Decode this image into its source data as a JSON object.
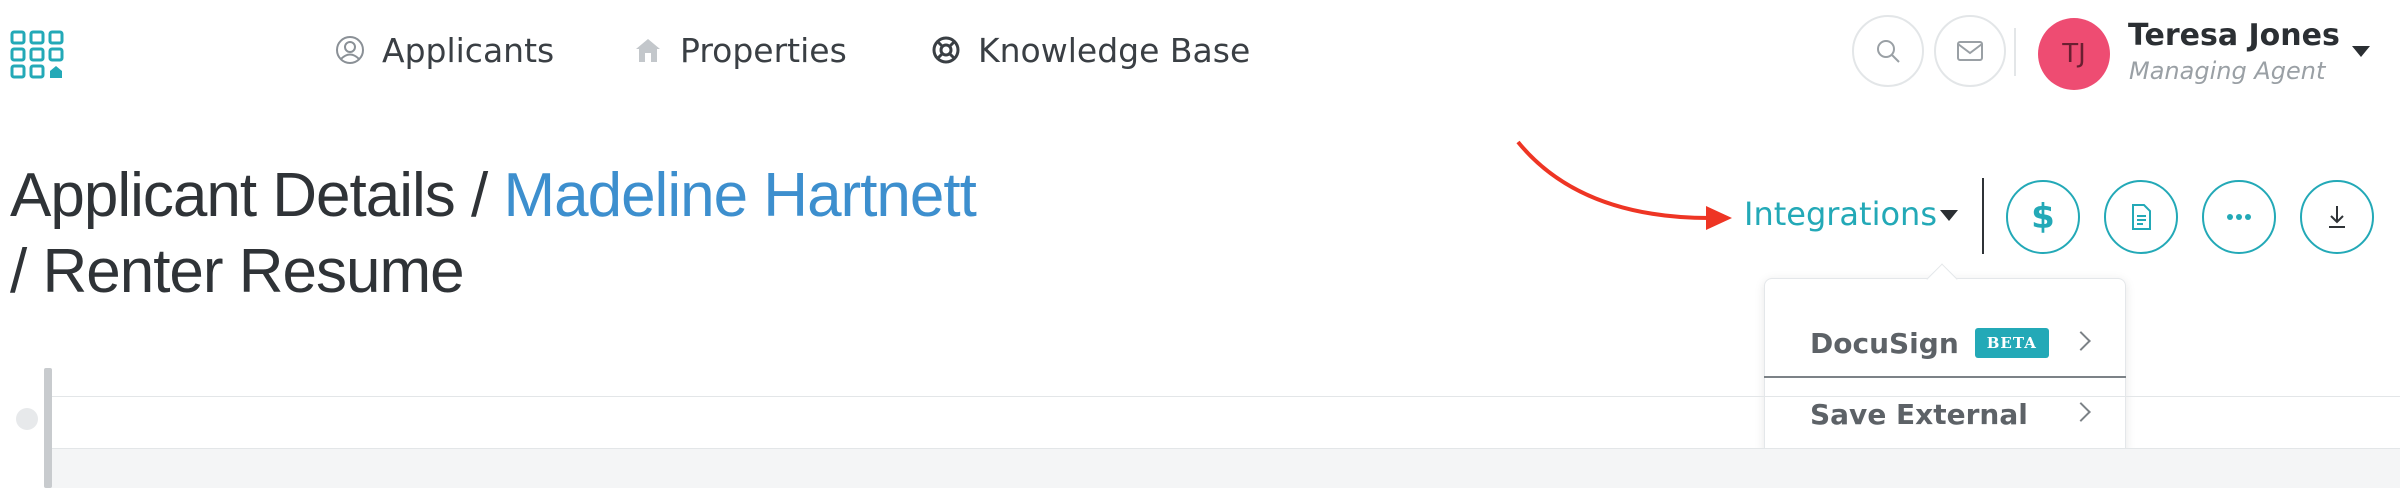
{
  "header": {
    "logo_icon": "grid-logo-icon",
    "nav": [
      {
        "label": "Applicants",
        "icon": "user-circle-icon"
      },
      {
        "label": "Properties",
        "icon": "house-icon"
      },
      {
        "label": "Knowledge Base",
        "icon": "lifebuoy-icon"
      }
    ],
    "search_icon": "search-icon",
    "mail_icon": "mail-icon",
    "user": {
      "initials": "TJ",
      "name": "Teresa Jones",
      "role": "Managing Agent",
      "avatar_color": "#ee4c72"
    }
  },
  "page": {
    "title_prefix": "Applicant Details / ",
    "title_link": "Madeline Hartnett",
    "title_suffix": "/ Renter Resume"
  },
  "toolbar": {
    "integrations_label": "Integrations",
    "accent_color": "#23a9b7",
    "buttons": [
      "dollar-icon",
      "document-icon",
      "more-icon",
      "download-icon"
    ]
  },
  "dropdown": {
    "items": [
      {
        "label": "DocuSign",
        "badge": "BETA"
      },
      {
        "label": "Save External"
      }
    ]
  },
  "annotation": {
    "color": "#ee3524"
  }
}
